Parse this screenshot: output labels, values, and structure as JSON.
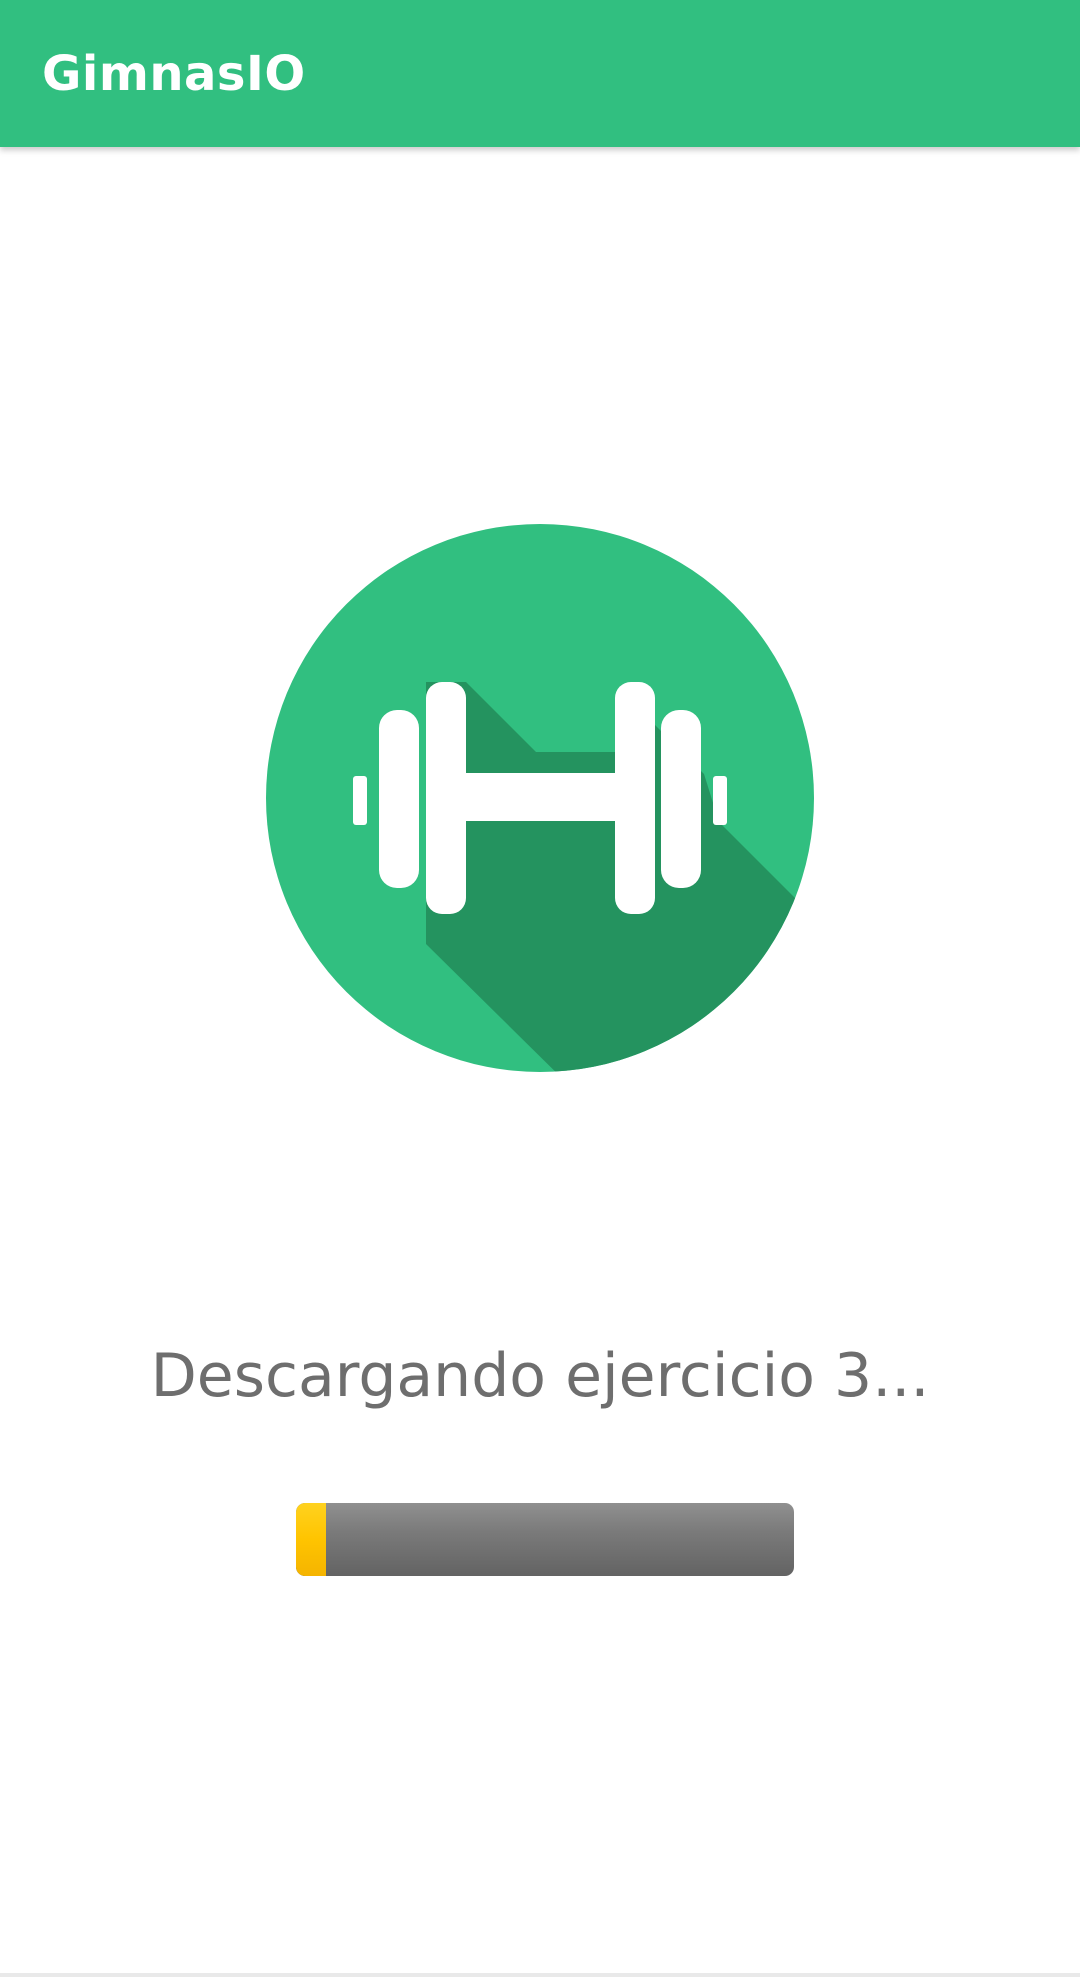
{
  "app_bar": {
    "title": "GimnasIO",
    "color": "#31bf80"
  },
  "logo": {
    "icon": "dumbbell-icon",
    "circle_color": "#31bf80",
    "shadow_color": "#24935f",
    "glyph_color": "#ffffff"
  },
  "status": {
    "text": "Descargando ejercicio 3..."
  },
  "progress": {
    "value": 0.06,
    "fill_color": "#ffc400",
    "track_color": "#6e6e6e"
  }
}
